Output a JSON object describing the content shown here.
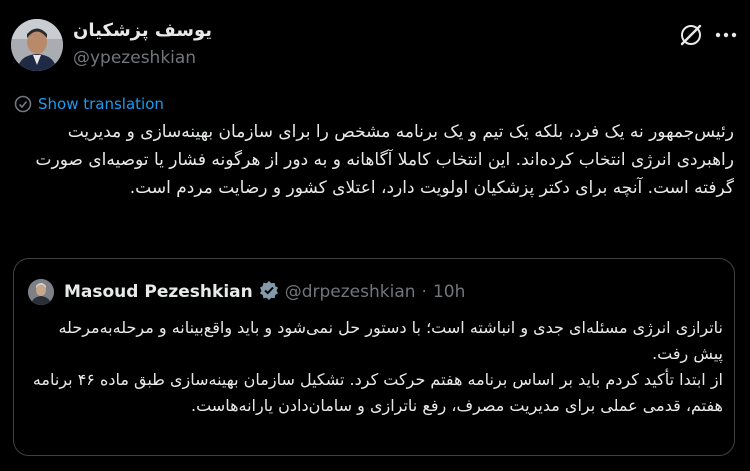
{
  "author": {
    "name": "یوسف پزشکیان",
    "handle": "@ypezeshkian"
  },
  "translation": {
    "label": "Show translation"
  },
  "tweet": {
    "text": "رئیس‌جمهور نه یک فرد، بلکه یک تیم و یک برنامه مشخص را برای سازمان بهینه‌سازی و مدیریت راهبردی انرژی انتخاب کرده‌اند. این انتخاب کاملا آگاهانه و به دور از هرگونه فشار یا توصیه‌ای صورت گرفته است. آنچه برای دکتر پزشکیان اولویت دارد، اعتلای کشور و رضایت مردم است."
  },
  "quote": {
    "name": "Masoud Pezeshkian",
    "handle": "@drpezeshkian",
    "separator": "·",
    "time": "10h",
    "paragraph1": "ناترازی انرژی مسئله‌ای جدی و انباشته است؛ با دستور حل نمی‌شود و باید واقع‌بینانه و مرحله‌به‌مرحله پیش رفت.",
    "paragraph2": "از ابتدا تأکید کردم باید بر اساس برنامه هفتم حرکت کرد. تشکیل سازمان بهینه‌سازی طبق ماده ۴۶ برنامه هفتم، قدمی عملی برای مدیریت مصرف، رفع ناترازی و سامان‌دادن یارانه‌هاست."
  },
  "icons": {
    "grok": "grok-icon",
    "more": "more-dots-icon",
    "translate": "translate-icon",
    "verified": "verified-badge-icon"
  },
  "colors": {
    "background": "#000000",
    "text": "#e7e9ea",
    "secondary": "#71767b",
    "link": "#1d9bf0",
    "border": "#3e4144"
  }
}
